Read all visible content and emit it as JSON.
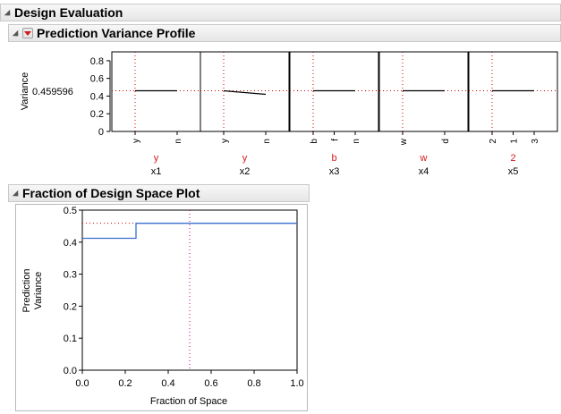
{
  "outline": {
    "root_title": "Design Evaluation",
    "profile_title": "Prediction Variance Profile",
    "fraction_title": "Fraction of Design Space Plot"
  },
  "colors": {
    "red": "#d41a1a",
    "blue": "#3a6fd0",
    "curve": "#000000",
    "crosshair_red": "#cc0000",
    "crosshair_magenta": "#c0007a"
  },
  "chart_data": [
    {
      "type": "line",
      "ylabel": "Variance",
      "current_value": "0.459596",
      "ylim": [
        0,
        0.9
      ],
      "yticks": [
        "0",
        "0.2",
        "0.4",
        "0.6",
        "0.8"
      ],
      "ytick_values": [
        0,
        0.2,
        0.4,
        0.6,
        0.8
      ],
      "factors": [
        {
          "name": "x1",
          "current": "y",
          "ticks": [
            "y",
            "n"
          ],
          "curve": [
            [
              0,
              0.46
            ],
            [
              1,
              0.46
            ]
          ],
          "current_pos": 0
        },
        {
          "name": "x2",
          "current": "y",
          "ticks": [
            "y",
            "n"
          ],
          "curve": [
            [
              0,
              0.46
            ],
            [
              1,
              0.42
            ]
          ],
          "current_pos": 0
        },
        {
          "name": "x3",
          "current": "b",
          "ticks": [
            "b",
            "f",
            "n"
          ],
          "curve": [
            [
              0,
              0.46
            ],
            [
              2,
              0.46
            ]
          ],
          "current_pos": 0
        },
        {
          "name": "x4",
          "current": "w",
          "ticks": [
            "w",
            "d"
          ],
          "curve": [
            [
              0,
              0.46
            ],
            [
              1,
              0.46
            ]
          ],
          "current_pos": 0
        },
        {
          "name": "x5",
          "current": "2",
          "ticks": [
            "2",
            "1",
            "3"
          ],
          "curve": [
            [
              0,
              0.46
            ],
            [
              2,
              0.46
            ]
          ],
          "current_pos": 0
        }
      ]
    },
    {
      "type": "line",
      "xlabel": "Fraction of Space",
      "ylabel": "Prediction Variance",
      "ylabel_lines": [
        "Prediction",
        "Variance"
      ],
      "xlim": [
        0,
        1
      ],
      "ylim": [
        0,
        0.5
      ],
      "xticks": [
        "0.0",
        "0.2",
        "0.4",
        "0.6",
        "0.8",
        "1.0"
      ],
      "xtick_values": [
        0,
        0.2,
        0.4,
        0.6,
        0.8,
        1.0
      ],
      "yticks": [
        "0.0",
        "0.1",
        "0.2",
        "0.3",
        "0.4",
        "0.5"
      ],
      "ytick_values": [
        0,
        0.1,
        0.2,
        0.3,
        0.4,
        0.5
      ],
      "series": [
        {
          "values": [
            [
              0,
              0.412
            ],
            [
              0.25,
              0.412
            ],
            [
              0.25,
              0.459
            ],
            [
              1.0,
              0.459
            ]
          ]
        }
      ],
      "ref_x": 0.5,
      "ref_y": 0.459
    }
  ]
}
